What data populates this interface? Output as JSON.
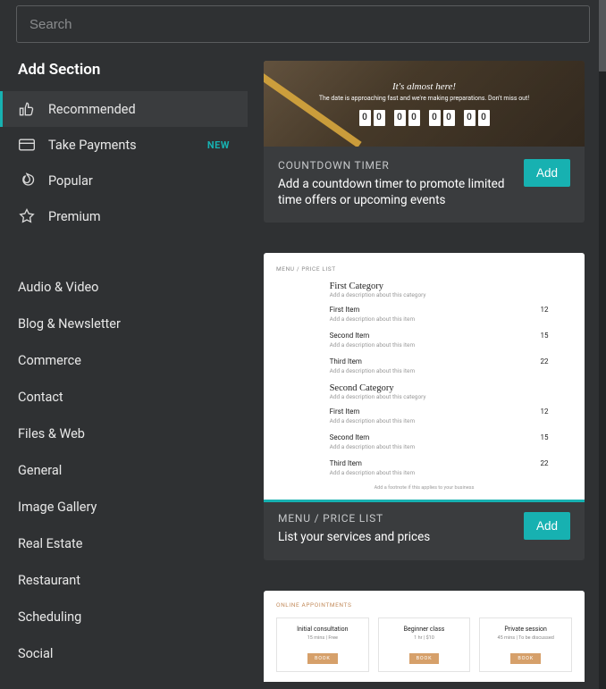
{
  "search": {
    "placeholder": "Search"
  },
  "sidebar": {
    "title": "Add Section",
    "nav": [
      {
        "id": "recommended",
        "label": "Recommended",
        "icon": "thumbs-up-icon",
        "active": true
      },
      {
        "id": "take-payments",
        "label": "Take Payments",
        "icon": "credit-card-icon",
        "badge": "NEW"
      },
      {
        "id": "popular",
        "label": "Popular",
        "icon": "flame-icon"
      },
      {
        "id": "premium",
        "label": "Premium",
        "icon": "star-icon"
      }
    ],
    "categories": [
      "Audio & Video",
      "Blog & Newsletter",
      "Commerce",
      "Contact",
      "Files & Web",
      "General",
      "Image Gallery",
      "Real Estate",
      "Restaurant",
      "Scheduling",
      "Social"
    ]
  },
  "buttons": {
    "add": "Add"
  },
  "sections": {
    "countdown": {
      "title": "COUNTDOWN TIMER",
      "desc": "Add a countdown timer to promote limited time offers or upcoming events",
      "preview": {
        "headline": "It's almost here!",
        "sub": "The date is approaching fast and we're making preparations. Don't miss out!",
        "digits": [
          "0",
          "0",
          "0",
          "0",
          "0",
          "0",
          "0",
          "0"
        ]
      }
    },
    "menu": {
      "title": "MENU / PRICE LIST",
      "desc": "List your services and prices",
      "selected": true,
      "preview": {
        "breadcrumb": "MENU / PRICE LIST",
        "categories": [
          {
            "name": "First Category",
            "desc": "Add a description about this category",
            "items": [
              {
                "name": "First Item",
                "desc": "Add a description about this item",
                "price": "12"
              },
              {
                "name": "Second Item",
                "desc": "Add a description about this item",
                "price": "15"
              },
              {
                "name": "Third Item",
                "desc": "Add a description about this item",
                "price": "22"
              }
            ]
          },
          {
            "name": "Second Category",
            "desc": "Add a description about this category",
            "items": [
              {
                "name": "First Item",
                "desc": "Add a description about this item",
                "price": "12"
              },
              {
                "name": "Second Item",
                "desc": "Add a description about this item",
                "price": "15"
              },
              {
                "name": "Third Item",
                "desc": "Add a description about this item",
                "price": "22"
              }
            ]
          }
        ],
        "footnote": "Add a footnote if this applies to your business"
      }
    },
    "appointments": {
      "title": "ONLINE APPOINTMENTS",
      "preview": {
        "breadcrumb": "ONLINE APPOINTMENTS",
        "cards": [
          {
            "title": "Initial consultation",
            "sub": "15 mins  |  Free",
            "btn": "BOOK"
          },
          {
            "title": "Beginner class",
            "sub": "1 hr  |  $10",
            "btn": "BOOK"
          },
          {
            "title": "Private session",
            "sub": "45 mins  |  To be discussed",
            "btn": "BOOK"
          }
        ]
      }
    }
  }
}
